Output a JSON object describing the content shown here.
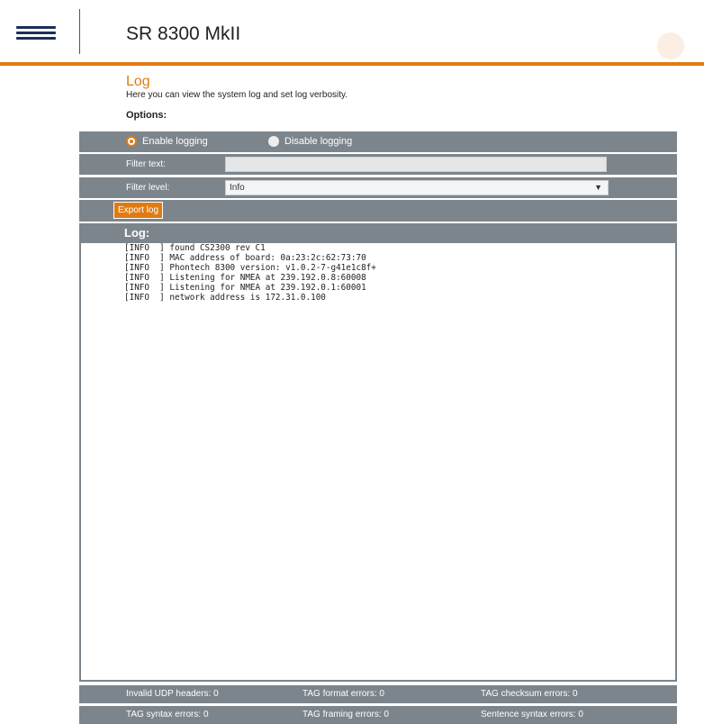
{
  "header": {
    "title": "SR 8300 MkII"
  },
  "page": {
    "title": "Log",
    "description": "Here you can view the system log and set log verbosity.",
    "options_label": "Options:"
  },
  "logging": {
    "enable_label": "Enable logging",
    "disable_label": "Disable logging",
    "selected": "enable"
  },
  "filter": {
    "text_label": "Filter text:",
    "text_value": "",
    "level_label": "Filter level:",
    "level_value": "Info"
  },
  "export": {
    "label": "Export log"
  },
  "log": {
    "header": "Log:",
    "lines": [
      "[INFO  ] found CS2300 rev C1",
      "[INFO  ] MAC address of board: 0a:23:2c:62:73:70",
      "[INFO  ] Phontech 8300 version: v1.0.2-7-g41e1c8f+",
      "[INFO  ] Listening for NMEA at 239.192.0.8:60008",
      "[INFO  ] Listening for NMEA at 239.192.0.1:60001",
      "[INFO  ] network address is 172.31.0.100"
    ]
  },
  "stats": {
    "invalid_udp": "Invalid UDP headers: 0",
    "tag_format": "TAG format errors: 0",
    "tag_checksum": "TAG checksum errors: 0",
    "tag_syntax": "TAG syntax errors: 0",
    "tag_framing": "TAG framing errors: 0",
    "sentence_syntax": "Sentence syntax errors: 0"
  },
  "colors": {
    "accent": "#e07b12",
    "panel": "#7d858c",
    "nav_icon": "#1a2f5a"
  }
}
